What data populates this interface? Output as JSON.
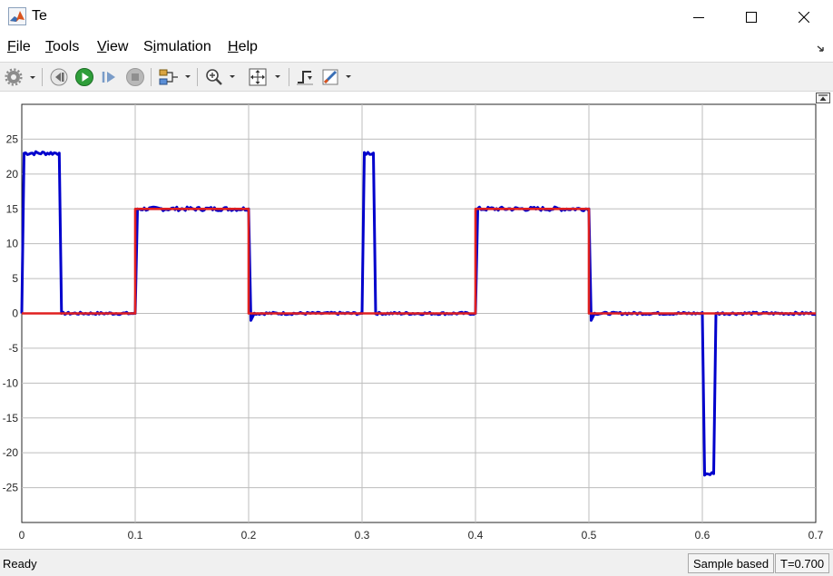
{
  "window": {
    "title": "Te",
    "minimize_icon": "minimize-icon",
    "maximize_icon": "maximize-icon",
    "close_icon": "close-icon"
  },
  "menubar": {
    "items": [
      {
        "label": "File",
        "key": "F"
      },
      {
        "label": "Tools",
        "key": "T"
      },
      {
        "label": "View",
        "key": "V"
      },
      {
        "label": "Simulation",
        "key": "i"
      },
      {
        "label": "Help",
        "key": "H"
      }
    ]
  },
  "toolbar": {
    "buttons": [
      {
        "icon": "settings-gear-icon",
        "dropdown": true
      },
      {
        "icon": "step-back-icon"
      },
      {
        "icon": "run-icon"
      },
      {
        "icon": "step-forward-icon"
      },
      {
        "icon": "stop-icon"
      },
      {
        "icon": "signal-selector-icon",
        "dropdown": true
      },
      {
        "icon": "zoom-in-icon",
        "dropdown": true
      },
      {
        "icon": "autoscale-icon",
        "dropdown": true
      },
      {
        "icon": "triggers-icon"
      },
      {
        "icon": "cursor-measurements-icon",
        "dropdown": true
      }
    ]
  },
  "chart_data": {
    "type": "line",
    "xlim": [
      0,
      0.7
    ],
    "ylim": [
      -30,
      30
    ],
    "x_ticks": [
      "0",
      "0.1",
      "0.2",
      "0.3",
      "0.4",
      "0.5",
      "0.6",
      "0.7"
    ],
    "y_ticks": [
      "25",
      "20",
      "15",
      "10",
      "5",
      "0",
      "-5",
      "-10",
      "-15",
      "-20",
      "-25"
    ],
    "grid": true,
    "legend": "none",
    "series": [
      {
        "color": "#0000cc",
        "x": [
          0,
          0.002,
          0.033,
          0.035,
          0.1,
          0.102,
          0.2,
          0.202,
          0.205,
          0.3,
          0.302,
          0.31,
          0.312,
          0.4,
          0.402,
          0.5,
          0.502,
          0.505,
          0.6,
          0.602,
          0.61,
          0.612,
          0.7
        ],
        "y": [
          0,
          23,
          23,
          0,
          0,
          15,
          15,
          -1,
          0,
          0,
          23,
          23,
          0,
          0,
          15,
          15,
          -1,
          0,
          0,
          -23,
          -23,
          0,
          0
        ]
      },
      {
        "color": "#e02020",
        "x": [
          0,
          0.1,
          0.1,
          0.2,
          0.2,
          0.4,
          0.4,
          0.5,
          0.5,
          0.7
        ],
        "y": [
          0,
          0,
          15,
          15,
          0,
          0,
          15,
          15,
          0,
          0
        ]
      }
    ]
  },
  "status": {
    "ready": "Ready",
    "mode": "Sample based",
    "time": "T=0.700"
  },
  "colors": {
    "axes_bg": "#ffffff",
    "grid": "#bdbdbd",
    "series_blue": "#0000cc",
    "series_red": "#e02020"
  }
}
